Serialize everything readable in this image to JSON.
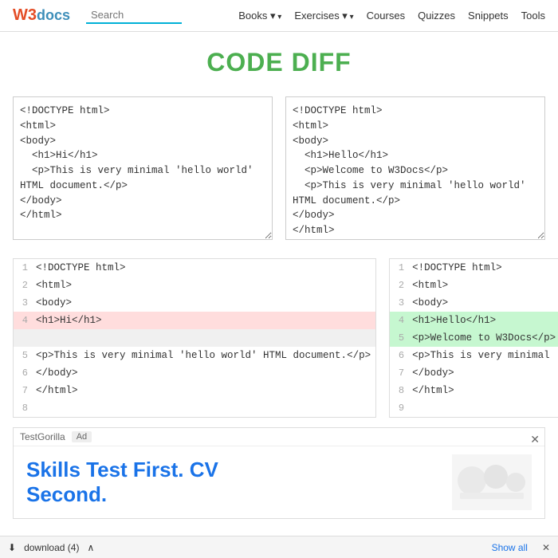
{
  "nav": {
    "logo_w3": "W3",
    "logo_docs": "docs",
    "search_placeholder": "Search",
    "links": [
      {
        "label": "Books",
        "dropdown": true
      },
      {
        "label": "Exercises",
        "dropdown": true
      },
      {
        "label": "Courses",
        "dropdown": false
      },
      {
        "label": "Quizzes",
        "dropdown": false
      },
      {
        "label": "Snippets",
        "dropdown": false
      },
      {
        "label": "Tools",
        "dropdown": false
      }
    ]
  },
  "page": {
    "title": "CODE DIFF",
    "textarea_left": "<!DOCTYPE html>\n<html>\n<body>\n  <h1>Hi</h1>\n  <p>This is very minimal 'hello world' HTML document.</p>\n</body>\n</html>",
    "textarea_right": "<!DOCTYPE html>\n<html>\n<body>\n  <h1>Hello</h1>\n  <p>Welcome to W3Docs</p>\n  <p>This is very minimal 'hello world' HTML document.</p>\n</body>\n</html>"
  },
  "diff": {
    "left": {
      "lines": [
        {
          "num": 1,
          "code": "<!DOCTYPE html>",
          "type": "normal"
        },
        {
          "num": 2,
          "code": "<html>",
          "type": "normal"
        },
        {
          "num": 3,
          "code": "<body>",
          "type": "normal"
        },
        {
          "num": 4,
          "code": "<h1>Hi</h1>",
          "type": "removed"
        },
        {
          "num": "",
          "code": "",
          "type": "empty"
        },
        {
          "num": 5,
          "code": "<p>This is very minimal 'hello world' HTML document.</p>",
          "type": "normal"
        },
        {
          "num": 6,
          "code": "</body>",
          "type": "normal"
        },
        {
          "num": 7,
          "code": "</html>",
          "type": "normal"
        },
        {
          "num": 8,
          "code": "",
          "type": "normal"
        }
      ]
    },
    "right": {
      "lines": [
        {
          "num": 1,
          "code": "<!DOCTYPE html>",
          "type": "normal"
        },
        {
          "num": 2,
          "code": "<html>",
          "type": "normal"
        },
        {
          "num": 3,
          "code": "<body>",
          "type": "normal"
        },
        {
          "num": 4,
          "code": "<h1>Hello</h1>",
          "type": "added"
        },
        {
          "num": 5,
          "code": "<p>Welcome to W3Docs</p>",
          "type": "added"
        },
        {
          "num": 6,
          "code": "<p>This is very minimal 'hello world' HTML document.</p>",
          "type": "normal"
        },
        {
          "num": 7,
          "code": "</body>",
          "type": "normal"
        },
        {
          "num": 8,
          "code": "</html>",
          "type": "normal"
        },
        {
          "num": 9,
          "code": "",
          "type": "normal"
        }
      ]
    }
  },
  "ad": {
    "tag": "TestGorilla",
    "badge": "Ad",
    "title_line1": "Skills Test First. CV",
    "title_line2": "Second."
  },
  "bottom_bar": {
    "download_label": "download (4)",
    "show_all": "Show all",
    "close": "✕"
  }
}
